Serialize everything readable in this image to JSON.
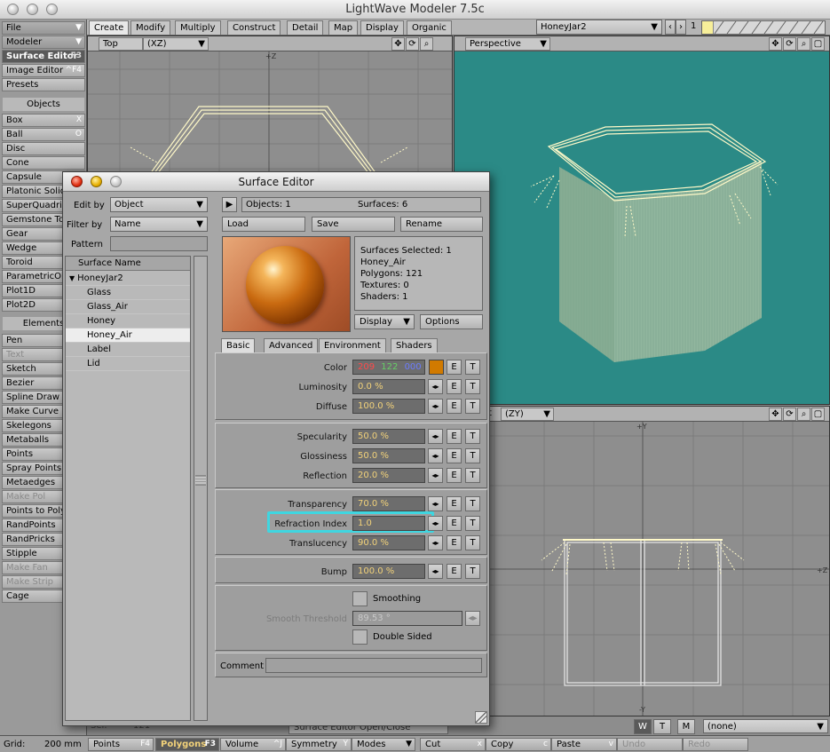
{
  "app": {
    "title": "LightWave Modeler 7.5c"
  },
  "tabs": [
    "Create",
    "Modify",
    "Multiply",
    "Construct",
    "Detail",
    "Map",
    "Display",
    "Organic"
  ],
  "object_selector": {
    "value": "HoneyJar2",
    "layer_number": "1"
  },
  "left_toolbar": {
    "top": [
      {
        "label": "File"
      },
      {
        "label": "Modeler"
      },
      {
        "label": "Surface Editor",
        "shortcut": "F3"
      },
      {
        "label": "Image Editor",
        "shortcut": "^F4"
      },
      {
        "label": "Presets"
      }
    ],
    "objects_header": "Objects",
    "objects": [
      {
        "label": "Box",
        "shortcut": "X"
      },
      {
        "label": "Ball",
        "shortcut": "O"
      },
      {
        "label": "Disc"
      },
      {
        "label": "Cone"
      },
      {
        "label": "Capsule"
      },
      {
        "label": "Platonic Solid"
      },
      {
        "label": "SuperQuadric"
      },
      {
        "label": "Gemstone Tool"
      },
      {
        "label": "Gear"
      },
      {
        "label": "Wedge"
      },
      {
        "label": "Toroid"
      },
      {
        "label": "ParametricObj"
      },
      {
        "label": "Plot1D"
      },
      {
        "label": "Plot2D"
      }
    ],
    "elements_header": "Elements",
    "elements": [
      {
        "label": "Pen"
      },
      {
        "label": "Text",
        "disabled": true
      },
      {
        "label": "Sketch"
      },
      {
        "label": "Bezier"
      },
      {
        "label": "Spline Draw"
      },
      {
        "label": "Make Curve"
      },
      {
        "label": "Skelegons"
      },
      {
        "label": "Metaballs"
      },
      {
        "label": "Points"
      },
      {
        "label": "Spray Points"
      },
      {
        "label": "Metaedges"
      },
      {
        "label": "Make Pol",
        "disabled": true
      },
      {
        "label": "Points to Polys"
      },
      {
        "label": "RandPoints"
      },
      {
        "label": "RandPricks"
      },
      {
        "label": "Stipple"
      },
      {
        "label": "Make Fan",
        "disabled": true
      },
      {
        "label": "Make Strip",
        "disabled": true
      },
      {
        "label": "Cage"
      }
    ]
  },
  "viewports": {
    "top_left": {
      "view": "Top",
      "axes": "(XZ)",
      "axis_label": "+Z"
    },
    "top_right": {
      "view": "Perspective"
    },
    "bottom_right": {
      "view_suffix": "t",
      "axes": "(ZY)",
      "axis_top": "+Y",
      "axis_side": "+Z",
      "axis_bottom": "-Y"
    }
  },
  "surface_editor": {
    "title": "Surface Editor",
    "edit_by_label": "Edit by",
    "edit_by_value": "Object",
    "filter_by_label": "Filter by",
    "filter_by_value": "Name",
    "pattern_label": "Pattern",
    "list_header": "Surface Name",
    "tree": [
      {
        "label": "HoneyJar2",
        "level": 0
      },
      {
        "label": "Glass",
        "level": 1
      },
      {
        "label": "Glass_Air",
        "level": 1
      },
      {
        "label": "Honey",
        "level": 1
      },
      {
        "label": "Honey_Air",
        "level": 1,
        "selected": true
      },
      {
        "label": "Label",
        "level": 1
      },
      {
        "label": "Lid",
        "level": 1
      }
    ],
    "objects_count": "Objects: 1",
    "surfaces_count": "Surfaces: 6",
    "load": "Load",
    "save": "Save",
    "rename": "Rename",
    "info": [
      "Surfaces Selected: 1",
      "Honey_Air",
      "Polygons: 121",
      "Textures: 0",
      "Shaders: 1"
    ],
    "display": "Display",
    "options": "Options",
    "subtabs": [
      "Basic",
      "Advanced",
      "Environment",
      "Shaders"
    ],
    "color": {
      "label": "Color",
      "r": "209",
      "g": "122",
      "b": "000",
      "swatch": "#d17a00"
    },
    "params": [
      {
        "label": "Luminosity",
        "value": "0.0 %"
      },
      {
        "label": "Diffuse",
        "value": "100.0 %"
      },
      {
        "label": "Specularity",
        "value": "50.0 %"
      },
      {
        "label": "Glossiness",
        "value": "50.0 %"
      },
      {
        "label": "Reflection",
        "value": "20.0 %"
      },
      {
        "label": "Transparency",
        "value": "70.0 %"
      },
      {
        "label": "Refraction Index",
        "value": "1.0"
      },
      {
        "label": "Translucency",
        "value": "90.0 %"
      },
      {
        "label": "Bump",
        "value": "100.0 %"
      }
    ],
    "e_label": "E",
    "t_label": "T",
    "smoothing": "Smoothing",
    "smooth_threshold_label": "Smooth Threshold",
    "smooth_threshold_value": "89.53 °",
    "double_sided": "Double Sided",
    "comment_label": "Comment",
    "highlight_color": "#3fd6e0"
  },
  "underlay": {
    "sel_label": "Sel:",
    "sel_count": "121",
    "surface_button": "Surface Editor Open/Close"
  },
  "mode_buttons": [
    "W",
    "T",
    "M"
  ],
  "none_selector": "(none)",
  "status_bar": {
    "grid_label": "Grid:",
    "grid_value": "200 mm",
    "buttons": [
      {
        "label": "Points",
        "shortcut": "F4"
      },
      {
        "label": "Polygons",
        "shortcut": "F3",
        "active": true
      },
      {
        "label": "Volume",
        "shortcut": "^J"
      },
      {
        "label": "Symmetry",
        "shortcut": "Y"
      },
      {
        "label": "Modes"
      },
      {
        "label": "Cut",
        "shortcut": "x"
      },
      {
        "label": "Copy",
        "shortcut": "c"
      },
      {
        "label": "Paste",
        "shortcut": "v"
      },
      {
        "label": "Undo",
        "disabled": true
      },
      {
        "label": "Redo",
        "disabled": true
      }
    ]
  },
  "colors": {
    "perspective_bg": "#2b8a86",
    "ortho_bg": "#8e8e8e",
    "wire": "#fff9c8"
  }
}
